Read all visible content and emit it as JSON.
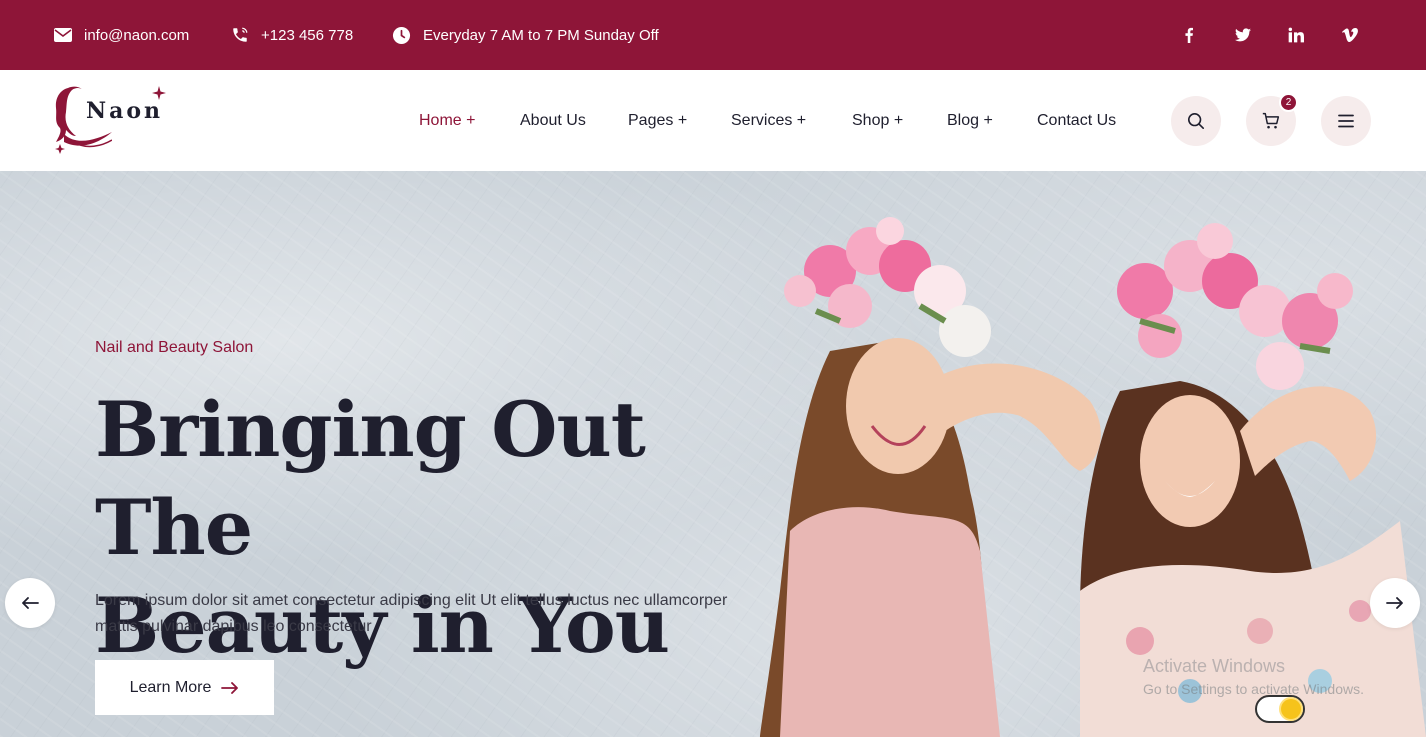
{
  "topbar": {
    "email": "info@naon.com",
    "phone": "+123 456 778",
    "hours": "Everyday 7 AM to 7 PM Sunday Off",
    "social": [
      "f",
      "twitter-icon",
      "in",
      "vimeo-icon"
    ]
  },
  "header": {
    "logo_text": "Naon",
    "nav": [
      {
        "label": "Home +"
      },
      {
        "label": "About Us"
      },
      {
        "label": "Pages +"
      },
      {
        "label": "Services +"
      },
      {
        "label": "Shop +"
      },
      {
        "label": "Blog +"
      },
      {
        "label": "Contact Us"
      }
    ],
    "cart_count": "2"
  },
  "hero": {
    "subtitle": "Nail and Beauty Salon",
    "headline_line1": "Bringing Out The",
    "headline_line2": "Beauty in You",
    "paragraph": "Lorem ipsum dolor sit amet consectetur adipiscing elit Ut elit tellus luctus nec ullamcorper mattis pulvinar dapibus leo consectetur",
    "cta_label": "Learn More"
  },
  "watermark": {
    "line1": "Activate Windows",
    "line2": "Go to Settings to activate Windows."
  },
  "colors": {
    "brand": "#8e1538",
    "dark": "#1f1f2e",
    "button_bg": "#f6ecec"
  }
}
